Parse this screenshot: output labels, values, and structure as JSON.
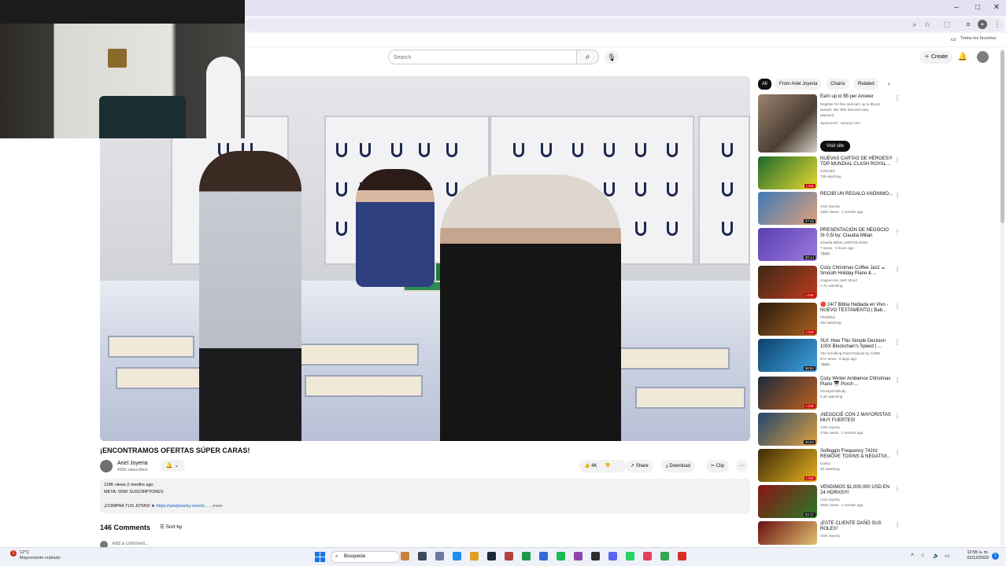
{
  "window": {
    "minimize": "–",
    "maximize": "□",
    "close": "✕"
  },
  "toolbar": {
    "bookmarks_folder": "Todos los favoritos"
  },
  "header": {
    "search_placeholder": "Search",
    "create_label": "Create",
    "search_icon": "search-icon",
    "mic_icon": "microphone-icon",
    "bell_icon": "bell-icon"
  },
  "video": {
    "title": "¡ENCONTRAMOS OFERTAS SÚPER CARAS!",
    "channel_name": "Ariel Joyeria",
    "channel_subs": "455K subscribers",
    "likes": "4K",
    "share_label": "Share",
    "download_label": "Download",
    "clip_label": "Clip"
  },
  "description": {
    "meta": "118K views  2 months ago",
    "line1": "META: 500K SUSCRIPTORES",
    "line2_prefix": "¡COMPRA TUS JOYAS! ➤",
    "link": "https://arieljewelry.com/si...",
    "more": "...more"
  },
  "comments": {
    "count_label": "146 Comments",
    "sort_label": "Sort by",
    "add_placeholder": "Add a comment..."
  },
  "sidebar": {
    "chips": [
      "All",
      "From Ariel Joyeria",
      "Chains",
      "Related"
    ],
    "ad": {
      "title": "Earn up to $5 per Answer",
      "body1": "Register for free and earn up to $5 per",
      "body2": "answer. We offer fast and easy",
      "body3": "payment.",
      "sponsor": "Sponsored · surveys.com",
      "visit_label": "Visit site"
    },
    "recommendations": [
      {
        "title": "NUEVAS CARTAS DE HÉROES!!! TOP MUNDIAL CLASH ROYAL...",
        "channel": "Pollorabit",
        "meta": "736 watching",
        "badge": "LIVE",
        "color_a": "#1c6a2c",
        "color_b": "#e8d830"
      },
      {
        "title": "RECIBÍ UN REGALO ANÓNIMO...",
        "channel": "Ariel Joyeria",
        "meta": "195K views · 2 months ago",
        "badge": "27:43",
        "color_a": "#3c7ab8",
        "color_b": "#e0a07a"
      },
      {
        "title": "PRESENTACIÓN DE NEGOCIO SI 0.5I by: Claudia Millan",
        "channel": "Claudia Millan UNOPOLOS93",
        "meta": "7 views · 6 hours ago",
        "extra": "New",
        "badge": "28:14",
        "color_a": "#5a3fb0",
        "color_b": "#9c7ae0"
      },
      {
        "title": "Cozy Christmas Coffee Jazz ☕ Smooth Holiday Piano & ...",
        "channel": "Cappuccino Jazz Mood",
        "meta": "1.7K watching",
        "badge": "LIVE",
        "color_a": "#3a2a18",
        "color_b": "#c03a1c"
      },
      {
        "title": "🔴 24/7 Biblia Hablada en Vivo - NUEVO TESTAMENTO | Bab...",
        "channel": "Pibolibluz",
        "meta": "454 watching",
        "badge": "LIVE",
        "color_a": "#2a1a0e",
        "color_b": "#a8621e"
      },
      {
        "title": "SUI: How This Simple Decision 100X Blockchain's Speed | ...",
        "channel": "The Scholling Point Podcast by CSBN",
        "meta": "574 views · 6 days ago",
        "extra": "New",
        "badge": "58:52",
        "color_a": "#0e3f6a",
        "color_b": "#3da3e0"
      },
      {
        "title": "Cozy Winter Ambience Christmas Piano 🎹 Porch ...",
        "channel": "Snowjail Melody",
        "meta": "6.2K watching",
        "badge": "LIVE",
        "color_a": "#1b2a3c",
        "color_b": "#c06020"
      },
      {
        "title": "¡NEGOCIÉ CON 2 MAYORISTAS MUY FUERTES!",
        "channel": "Ariel Joyeria",
        "meta": "176K views · 2 months ago",
        "badge": "30:24",
        "color_a": "#22446e",
        "color_b": "#e0a03c"
      },
      {
        "title": "Solfeggio Frequency 741hz REMOVE TOXINS & NEGATIVI...",
        "channel": "Calmy",
        "meta": "2K watching",
        "badge": "LIVE",
        "color_a": "#3a2a08",
        "color_b": "#e8b020"
      },
      {
        "title": "VENDIMOS $1,000,000 USD EN 24 HORAS!!!!",
        "channel": "Ariel Joyeria",
        "meta": "264K views · 2 months ago",
        "badge": "53:17",
        "color_a": "#8a1414",
        "color_b": "#2a7a2a"
      },
      {
        "title": "¡ESTE CLIENTE DAÑÓ SUS ROLEX!",
        "channel": "Ariel Joyeria",
        "meta": "",
        "badge": "",
        "color_a": "#6a1010",
        "color_b": "#e0c070"
      }
    ]
  },
  "taskbar": {
    "weather_temp": "12°C",
    "weather_desc": "Mayormente nublado",
    "search_label": "Búsqueda",
    "time": "12:55 a. m.",
    "date": "01/12/2023",
    "notif_count": "1",
    "app_colors": [
      "#c9823a",
      "#3c4a5a",
      "#6c7aa0",
      "#1f8ef1",
      "#e0a020",
      "#1b2838",
      "#b0413e",
      "#1c9a4a",
      "#2f6ad8",
      "#1db954",
      "#8e44ad",
      "#2c2c2c",
      "#5865f2",
      "#25d366",
      "#e4405f",
      "#34a853",
      "#d93025"
    ]
  }
}
